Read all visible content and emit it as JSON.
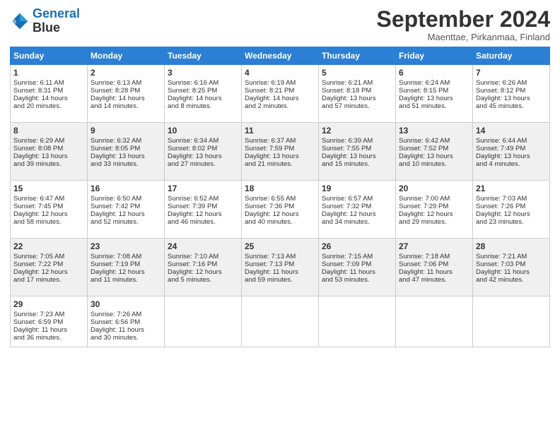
{
  "logo": {
    "text_general": "General",
    "text_blue": "Blue"
  },
  "title": "September 2024",
  "subtitle": "Maenttae, Pirkanmaa, Finland",
  "weekdays": [
    "Sunday",
    "Monday",
    "Tuesday",
    "Wednesday",
    "Thursday",
    "Friday",
    "Saturday"
  ],
  "weeks": [
    [
      {
        "day": "1",
        "line1": "Sunrise: 6:11 AM",
        "line2": "Sunset: 8:31 PM",
        "line3": "Daylight: 14 hours",
        "line4": "and 20 minutes."
      },
      {
        "day": "2",
        "line1": "Sunrise: 6:13 AM",
        "line2": "Sunset: 8:28 PM",
        "line3": "Daylight: 14 hours",
        "line4": "and 14 minutes."
      },
      {
        "day": "3",
        "line1": "Sunrise: 6:16 AM",
        "line2": "Sunset: 8:25 PM",
        "line3": "Daylight: 14 hours",
        "line4": "and 8 minutes."
      },
      {
        "day": "4",
        "line1": "Sunrise: 6:19 AM",
        "line2": "Sunset: 8:21 PM",
        "line3": "Daylight: 14 hours",
        "line4": "and 2 minutes."
      },
      {
        "day": "5",
        "line1": "Sunrise: 6:21 AM",
        "line2": "Sunset: 8:18 PM",
        "line3": "Daylight: 13 hours",
        "line4": "and 57 minutes."
      },
      {
        "day": "6",
        "line1": "Sunrise: 6:24 AM",
        "line2": "Sunset: 8:15 PM",
        "line3": "Daylight: 13 hours",
        "line4": "and 51 minutes."
      },
      {
        "day": "7",
        "line1": "Sunrise: 6:26 AM",
        "line2": "Sunset: 8:12 PM",
        "line3": "Daylight: 13 hours",
        "line4": "and 45 minutes."
      }
    ],
    [
      {
        "day": "8",
        "line1": "Sunrise: 6:29 AM",
        "line2": "Sunset: 8:08 PM",
        "line3": "Daylight: 13 hours",
        "line4": "and 39 minutes."
      },
      {
        "day": "9",
        "line1": "Sunrise: 6:32 AM",
        "line2": "Sunset: 8:05 PM",
        "line3": "Daylight: 13 hours",
        "line4": "and 33 minutes."
      },
      {
        "day": "10",
        "line1": "Sunrise: 6:34 AM",
        "line2": "Sunset: 8:02 PM",
        "line3": "Daylight: 13 hours",
        "line4": "and 27 minutes."
      },
      {
        "day": "11",
        "line1": "Sunrise: 6:37 AM",
        "line2": "Sunset: 7:59 PM",
        "line3": "Daylight: 13 hours",
        "line4": "and 21 minutes."
      },
      {
        "day": "12",
        "line1": "Sunrise: 6:39 AM",
        "line2": "Sunset: 7:55 PM",
        "line3": "Daylight: 13 hours",
        "line4": "and 15 minutes."
      },
      {
        "day": "13",
        "line1": "Sunrise: 6:42 AM",
        "line2": "Sunset: 7:52 PM",
        "line3": "Daylight: 13 hours",
        "line4": "and 10 minutes."
      },
      {
        "day": "14",
        "line1": "Sunrise: 6:44 AM",
        "line2": "Sunset: 7:49 PM",
        "line3": "Daylight: 13 hours",
        "line4": "and 4 minutes."
      }
    ],
    [
      {
        "day": "15",
        "line1": "Sunrise: 6:47 AM",
        "line2": "Sunset: 7:45 PM",
        "line3": "Daylight: 12 hours",
        "line4": "and 58 minutes."
      },
      {
        "day": "16",
        "line1": "Sunrise: 6:50 AM",
        "line2": "Sunset: 7:42 PM",
        "line3": "Daylight: 12 hours",
        "line4": "and 52 minutes."
      },
      {
        "day": "17",
        "line1": "Sunrise: 6:52 AM",
        "line2": "Sunset: 7:39 PM",
        "line3": "Daylight: 12 hours",
        "line4": "and 46 minutes."
      },
      {
        "day": "18",
        "line1": "Sunrise: 6:55 AM",
        "line2": "Sunset: 7:36 PM",
        "line3": "Daylight: 12 hours",
        "line4": "and 40 minutes."
      },
      {
        "day": "19",
        "line1": "Sunrise: 6:57 AM",
        "line2": "Sunset: 7:32 PM",
        "line3": "Daylight: 12 hours",
        "line4": "and 34 minutes."
      },
      {
        "day": "20",
        "line1": "Sunrise: 7:00 AM",
        "line2": "Sunset: 7:29 PM",
        "line3": "Daylight: 12 hours",
        "line4": "and 29 minutes."
      },
      {
        "day": "21",
        "line1": "Sunrise: 7:03 AM",
        "line2": "Sunset: 7:26 PM",
        "line3": "Daylight: 12 hours",
        "line4": "and 23 minutes."
      }
    ],
    [
      {
        "day": "22",
        "line1": "Sunrise: 7:05 AM",
        "line2": "Sunset: 7:22 PM",
        "line3": "Daylight: 12 hours",
        "line4": "and 17 minutes."
      },
      {
        "day": "23",
        "line1": "Sunrise: 7:08 AM",
        "line2": "Sunset: 7:19 PM",
        "line3": "Daylight: 12 hours",
        "line4": "and 11 minutes."
      },
      {
        "day": "24",
        "line1": "Sunrise: 7:10 AM",
        "line2": "Sunset: 7:16 PM",
        "line3": "Daylight: 12 hours",
        "line4": "and 5 minutes."
      },
      {
        "day": "25",
        "line1": "Sunrise: 7:13 AM",
        "line2": "Sunset: 7:13 PM",
        "line3": "Daylight: 11 hours",
        "line4": "and 59 minutes."
      },
      {
        "day": "26",
        "line1": "Sunrise: 7:15 AM",
        "line2": "Sunset: 7:09 PM",
        "line3": "Daylight: 11 hours",
        "line4": "and 53 minutes."
      },
      {
        "day": "27",
        "line1": "Sunrise: 7:18 AM",
        "line2": "Sunset: 7:06 PM",
        "line3": "Daylight: 11 hours",
        "line4": "and 47 minutes."
      },
      {
        "day": "28",
        "line1": "Sunrise: 7:21 AM",
        "line2": "Sunset: 7:03 PM",
        "line3": "Daylight: 11 hours",
        "line4": "and 42 minutes."
      }
    ],
    [
      {
        "day": "29",
        "line1": "Sunrise: 7:23 AM",
        "line2": "Sunset: 6:59 PM",
        "line3": "Daylight: 11 hours",
        "line4": "and 36 minutes."
      },
      {
        "day": "30",
        "line1": "Sunrise: 7:26 AM",
        "line2": "Sunset: 6:56 PM",
        "line3": "Daylight: 11 hours",
        "line4": "and 30 minutes."
      },
      null,
      null,
      null,
      null,
      null
    ]
  ]
}
